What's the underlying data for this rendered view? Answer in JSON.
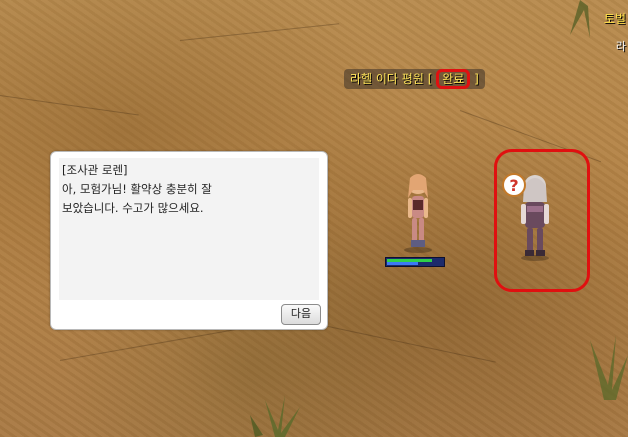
{
  "hud": {
    "top_right_label": "토벌",
    "top_right_label2": "라"
  },
  "quest": {
    "name": "라헬 이다 평원",
    "bracket_open": "[",
    "status": "완료",
    "bracket_close": "]"
  },
  "dialog": {
    "speaker": "[조사관 로렌]",
    "line1": "아, 모험가님! 활약상 충분히 잘",
    "line2": "보았습니다. 수고가 많으세요.",
    "next_label": "다음"
  },
  "player": {
    "hp_fraction": 0.8,
    "sp_fraction": 0.55
  },
  "colors": {
    "highlight": "#e01010",
    "quest_text": "#ffe45a",
    "hp": "#2fd04a",
    "sp": "#3c79f5"
  },
  "npc": {
    "quest_icon": "question-mark-icon"
  }
}
